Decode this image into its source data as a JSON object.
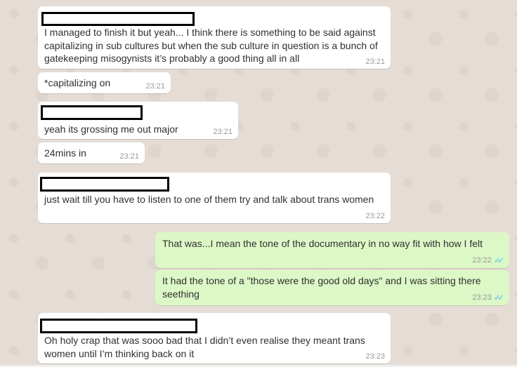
{
  "messages": [
    {
      "direction": "in",
      "has_redacted_name": true,
      "text": "I managed to finish it but yeah... I think there is something to be said against capitalizing in sub cultures but when the sub culture in question is a bunch of gatekeeping misogynists it’s probably a good thing all in all",
      "time": "23:21"
    },
    {
      "direction": "in",
      "has_redacted_name": false,
      "text": "*capitalizing on",
      "time": "23:21"
    },
    {
      "direction": "in",
      "has_redacted_name": true,
      "text": "yeah its grossing me out major",
      "time": "23:21"
    },
    {
      "direction": "in",
      "has_redacted_name": false,
      "text": "24mins in",
      "time": "23:21"
    },
    {
      "direction": "in",
      "has_redacted_name": true,
      "text": "just wait till you have to listen to one of them try and talk about trans women",
      "time": "23:22"
    },
    {
      "direction": "out",
      "has_redacted_name": false,
      "text": "That was...I mean the tone of the documentary in no way fit with how I felt",
      "time": "23:22",
      "status": "read"
    },
    {
      "direction": "out",
      "has_redacted_name": false,
      "text": "It had the tone of a \"those were the good old days\" and I was sitting there seething",
      "time": "23:23",
      "status": "read"
    },
    {
      "direction": "in",
      "has_redacted_name": true,
      "text": "Oh holy crap that was sooo bad that I didn’t even realise they meant trans women until I’m thinking back on it",
      "time": "23:23"
    }
  ],
  "icons": {
    "read_receipt": "double-check-icon"
  },
  "colors": {
    "incoming": "#ffffff",
    "outgoing": "#dcf8c6",
    "background": "#e5ddd5",
    "read_tick": "#4fc3f7"
  }
}
